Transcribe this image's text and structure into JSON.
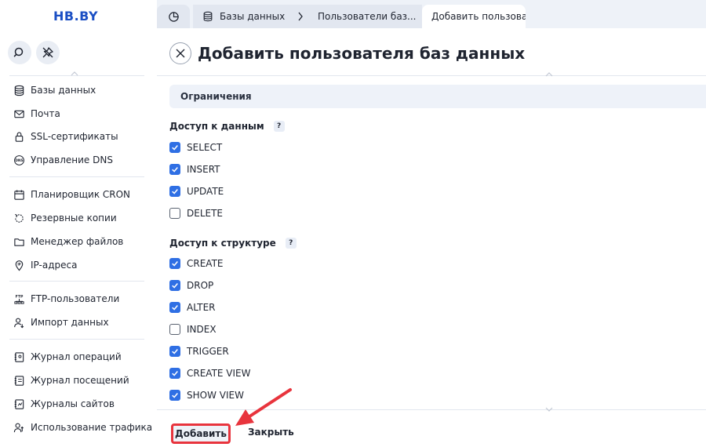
{
  "brand": {
    "logo": "HB.BY"
  },
  "sidebar": {
    "groups": [
      [
        {
          "label": "Базы данных",
          "icon": "database-icon"
        },
        {
          "label": "Почта",
          "icon": "mail-icon"
        },
        {
          "label": "SSL-сертификаты",
          "icon": "lock-icon"
        },
        {
          "label": "Управление DNS",
          "icon": "dns-icon"
        }
      ],
      [
        {
          "label": "Планировщик CRON",
          "icon": "calendar-icon"
        },
        {
          "label": "Резервные копии",
          "icon": "backup-icon"
        },
        {
          "label": "Менеджер файлов",
          "icon": "folder-icon"
        },
        {
          "label": "IP-адреса",
          "icon": "ip-icon"
        }
      ],
      [
        {
          "label": "FTP-пользователи",
          "icon": "ftp-icon"
        },
        {
          "label": "Импорт данных",
          "icon": "user-import-icon"
        }
      ],
      [
        {
          "label": "Журнал операций",
          "icon": "journal-icon"
        },
        {
          "label": "Журнал посещений",
          "icon": "visits-log-icon"
        },
        {
          "label": "Журналы сайтов",
          "icon": "site-logs-icon"
        },
        {
          "label": "Использование трафика",
          "icon": "traffic-icon"
        }
      ]
    ]
  },
  "tabs": [
    {
      "label": "Базы данных",
      "icon": "database-icon"
    },
    {
      "label": "Пользователи баз..."
    },
    {
      "label": "Добавить пользова..."
    }
  ],
  "dialog": {
    "title": "Добавить пользователя баз данных",
    "section": "Ограничения",
    "groups": [
      {
        "label": "Доступ к данным",
        "help": "?",
        "options": [
          {
            "label": "SELECT",
            "checked": true
          },
          {
            "label": "INSERT",
            "checked": true
          },
          {
            "label": "UPDATE",
            "checked": true
          },
          {
            "label": "DELETE",
            "checked": false
          }
        ]
      },
      {
        "label": "Доступ к структуре",
        "help": "?",
        "options": [
          {
            "label": "CREATE",
            "checked": true
          },
          {
            "label": "DROP",
            "checked": true
          },
          {
            "label": "ALTER",
            "checked": true
          },
          {
            "label": "INDEX",
            "checked": false
          },
          {
            "label": "TRIGGER",
            "checked": true
          },
          {
            "label": "CREATE VIEW",
            "checked": true
          },
          {
            "label": "SHOW VIEW",
            "checked": true
          }
        ]
      }
    ],
    "buttons": {
      "add": "Добавить",
      "close": "Закрыть"
    }
  },
  "colors": {
    "accent": "#2f6fe4",
    "brand": "#1b4fc4",
    "highlight": "#e8343d"
  }
}
